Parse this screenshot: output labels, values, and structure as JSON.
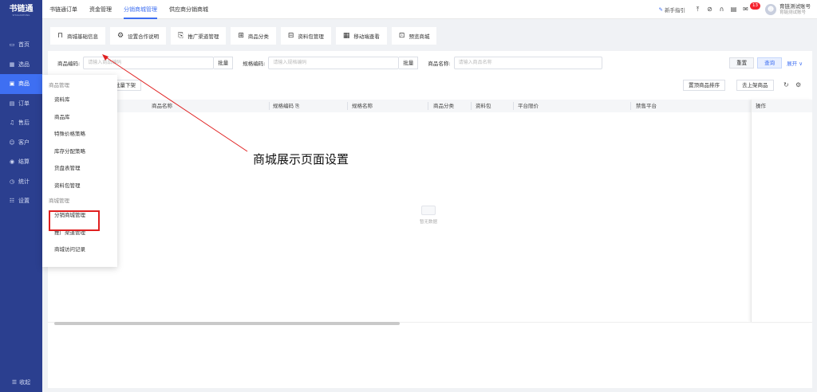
{
  "app": {
    "logo_title": "书链通",
    "logo_subtitle": "SHULIANTONG"
  },
  "sidebar": {
    "items": [
      {
        "icon": "monitor-icon",
        "label": "首页"
      },
      {
        "icon": "grid-icon",
        "label": "选品"
      },
      {
        "icon": "box-icon",
        "label": "商品"
      },
      {
        "icon": "order-icon",
        "label": "订单"
      },
      {
        "icon": "headset-icon",
        "label": "售后"
      },
      {
        "icon": "users-icon",
        "label": "客户"
      },
      {
        "icon": "settle-icon",
        "label": "结算"
      },
      {
        "icon": "clock-icon",
        "label": "统计"
      },
      {
        "icon": "settings-list-icon",
        "label": "设置"
      }
    ],
    "active_index": 2,
    "collapse_label": "收起"
  },
  "header": {
    "tabs": [
      "书链通订单",
      "资金管理",
      "分销商城管理",
      "供应商分销商城"
    ],
    "active_tab": 2,
    "guide_label": "新手指引",
    "notification_count": "13",
    "account_name": "育链测试账号",
    "account_sub": "育链测试账号"
  },
  "subtoolbar": {
    "buttons": [
      {
        "icon": "bag-icon",
        "label": "商城基础信息"
      },
      {
        "icon": "gear-icon",
        "label": "设置合作说明"
      },
      {
        "icon": "document-search-icon",
        "label": "推广渠道管理"
      },
      {
        "icon": "apps-icon",
        "label": "商品分类"
      },
      {
        "icon": "folder-icon",
        "label": "资料包管理"
      },
      {
        "icon": "qrcode-icon",
        "label": "移动端查看"
      },
      {
        "icon": "preview-icon",
        "label": "预览商城"
      }
    ]
  },
  "filters": {
    "product_code_label": "商品编码:",
    "product_code_placeholder": "请输入商品编码",
    "batch_label": "批量",
    "spec_code_label": "规格编码:",
    "spec_code_placeholder": "请输入规格编码",
    "product_name_label": "商品名称:",
    "product_name_placeholder": "请输入商品名称",
    "reset_label": "重置",
    "query_label": "查询",
    "expand_label": "展开"
  },
  "actions": {
    "batch_off_label": "批量下架",
    "pin_sort_label": "置顶商品排序",
    "go_list_label": "去上架商品"
  },
  "table": {
    "columns": [
      "商品名称",
      "规格编码",
      "规格名称",
      "商品分类",
      "资料包",
      "平台限价",
      "禁售平台",
      "操作"
    ],
    "empty_text": "暂无数据"
  },
  "menu": {
    "group1_title": "商品管理",
    "group1_items": [
      "资料库",
      "商品库",
      "特殊价格策略",
      "库存分配策略",
      "货盘表管理",
      "资料包管理"
    ],
    "group2_title": "商城管理",
    "group2_items": [
      "分销商城管理",
      "推广渠道管理",
      "商城访问记录"
    ],
    "highlighted_item": "分销商城管理"
  },
  "annotation": {
    "text": "商城展示页面设置",
    "color": "#e02020"
  }
}
